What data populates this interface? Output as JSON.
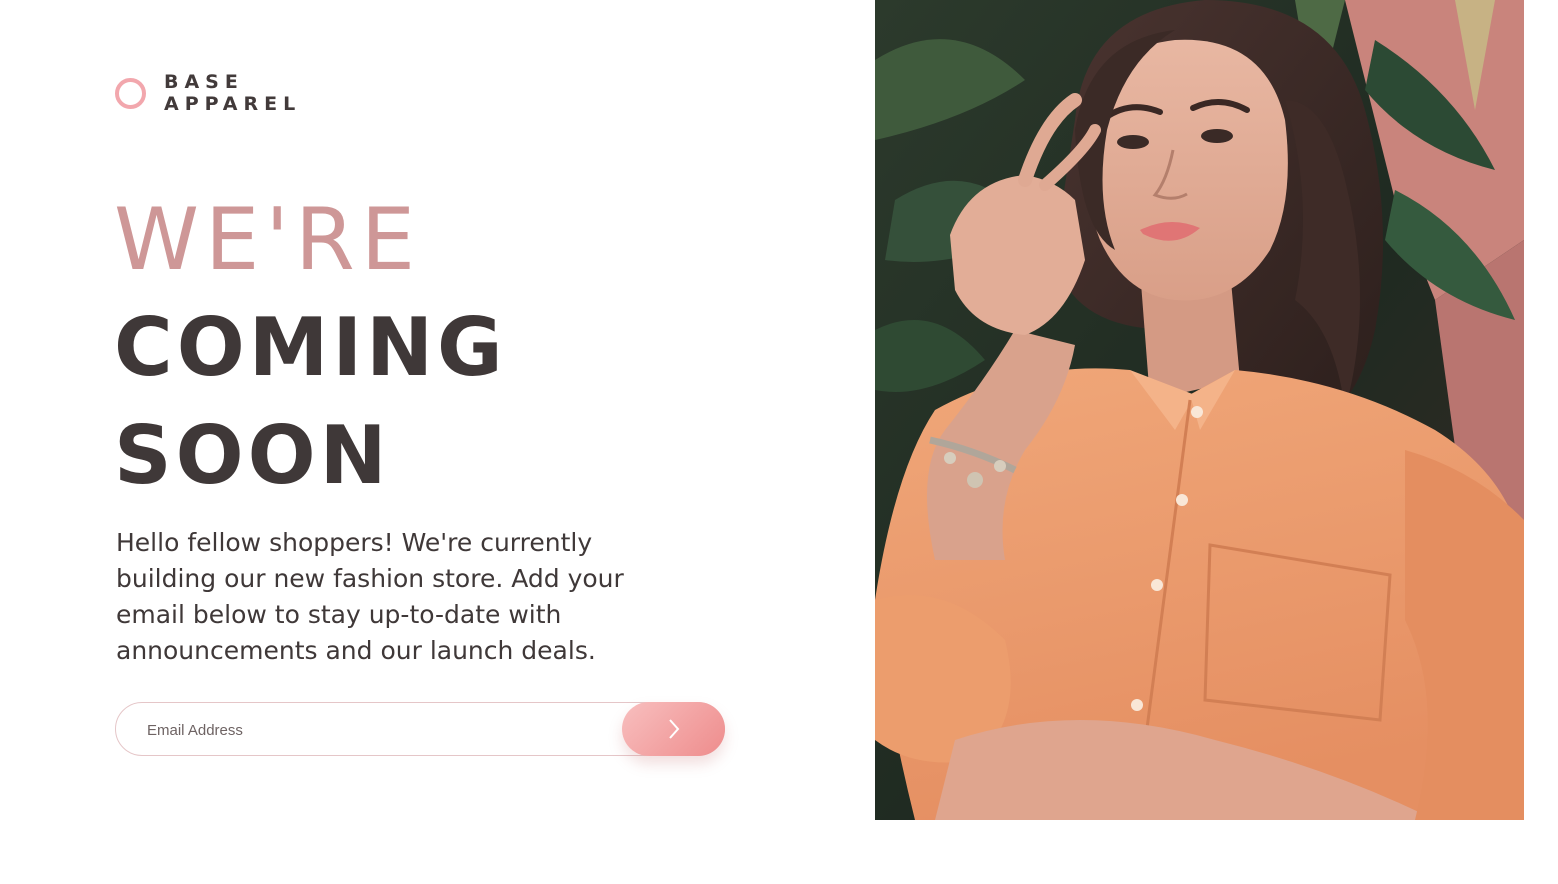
{
  "brand": {
    "line1": "BASE",
    "line2": "APPAREL",
    "accent_color": "#f2a7ad"
  },
  "headline": {
    "light": "WE'RE",
    "bold_line1": "COMING",
    "bold_line2": "SOON",
    "light_color": "#ce9797",
    "bold_color": "#3f3838"
  },
  "description": "Hello fellow shoppers! We're currently building our new fashion store. Add your email below to stay up-to-date with announcements and our launch deals.",
  "email_form": {
    "value": "",
    "placeholder": "Email Address",
    "submit_icon": "chevron-right-icon",
    "button_gradient": [
      "#f8bfbf",
      "#ee8c8c"
    ]
  },
  "hero": {
    "icon": "hero-photo"
  }
}
